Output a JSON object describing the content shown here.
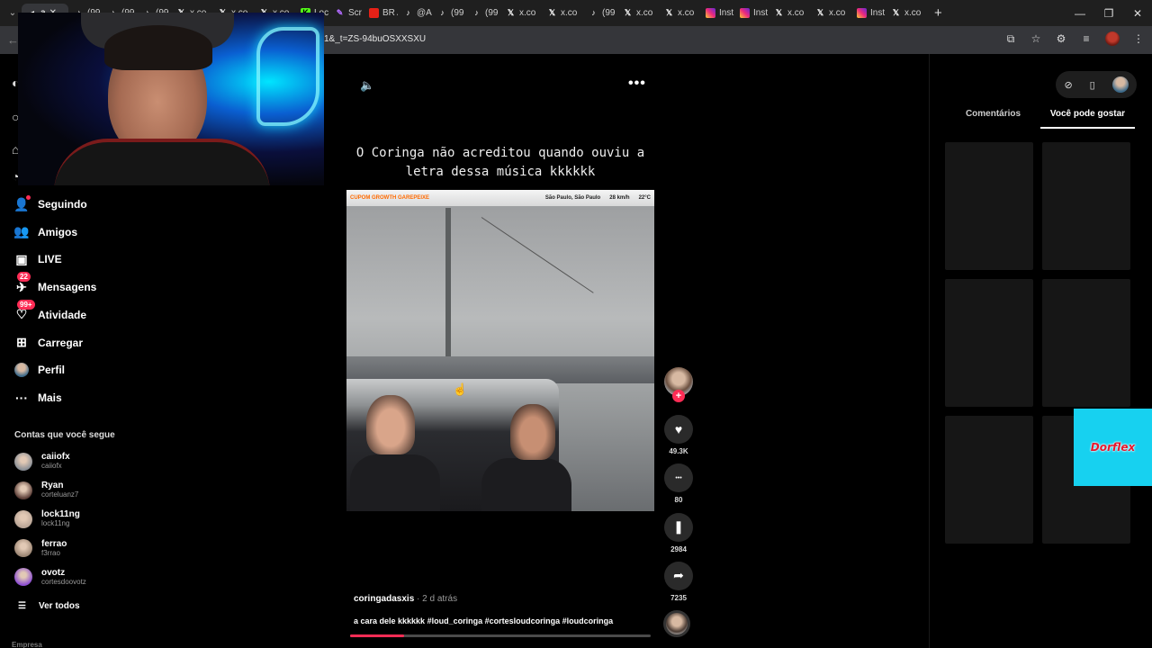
{
  "browser": {
    "tabs": [
      {
        "icon": "active-tab-icon",
        "label": "a",
        "type": "active"
      },
      {
        "icon": "tiktok-icon",
        "label": "(99",
        "type": "tt"
      },
      {
        "icon": "tiktok-icon",
        "label": "(99",
        "type": "tt"
      },
      {
        "icon": "tiktok-icon",
        "label": "(99",
        "type": "tt"
      },
      {
        "icon": "x-icon",
        "label": "x.co",
        "type": "x"
      },
      {
        "icon": "x-icon",
        "label": "x.co",
        "type": "x"
      },
      {
        "icon": "x-icon",
        "label": "x.co",
        "type": "x"
      },
      {
        "icon": "kick-icon",
        "label": "Loc",
        "type": "k"
      },
      {
        "icon": "screen-icon",
        "label": "Scr",
        "type": "sc"
      },
      {
        "icon": "youtube-icon",
        "label": "BR A",
        "type": "yt"
      },
      {
        "icon": "tiktok-icon",
        "label": "@A",
        "type": "tt"
      },
      {
        "icon": "tiktok-icon",
        "label": "(99",
        "type": "tt"
      },
      {
        "icon": "tiktok-icon",
        "label": "(99",
        "type": "tt"
      },
      {
        "icon": "x-icon",
        "label": "x.co",
        "type": "x"
      },
      {
        "icon": "x-icon",
        "label": "x.co",
        "type": "x"
      },
      {
        "icon": "tiktok-icon",
        "label": "(99",
        "type": "tt"
      },
      {
        "icon": "x-icon",
        "label": "x.co",
        "type": "x"
      },
      {
        "icon": "x-icon",
        "label": "x.co",
        "type": "x"
      },
      {
        "icon": "instagram-icon",
        "label": "Inst",
        "type": "ig"
      },
      {
        "icon": "instagram-icon",
        "label": "Inst",
        "type": "ig"
      },
      {
        "icon": "x-icon",
        "label": "x.co",
        "type": "x"
      },
      {
        "icon": "x-icon",
        "label": "x.co",
        "type": "x"
      },
      {
        "icon": "instagram-icon",
        "label": "Inst",
        "type": "ig"
      },
      {
        "icon": "x-icon",
        "label": "x.co",
        "type": "x"
      }
    ],
    "url": "1&_t=ZS-94buOSXXSXU"
  },
  "sidebar": {
    "items": [
      {
        "label": "Seguindo",
        "icon": "following-icon",
        "badge": "",
        "dot": true
      },
      {
        "label": "Amigos",
        "icon": "friends-icon",
        "badge": "",
        "dot": false
      },
      {
        "label": "LIVE",
        "icon": "live-icon",
        "badge": "",
        "dot": false
      },
      {
        "label": "Mensagens",
        "icon": "messages-icon",
        "badge": "22",
        "dot": false
      },
      {
        "label": "Atividade",
        "icon": "activity-icon",
        "badge": "99+",
        "dot": false
      },
      {
        "label": "Carregar",
        "icon": "upload-icon",
        "badge": "",
        "dot": false
      },
      {
        "label": "Perfil",
        "icon": "profile-avatar",
        "badge": "",
        "dot": false
      },
      {
        "label": "Mais",
        "icon": "more-icon",
        "badge": "",
        "dot": false
      }
    ],
    "following_title": "Contas que você segue",
    "accounts": [
      {
        "name": "caiiofx",
        "handle": "caiiofx",
        "color": "#8a8f96"
      },
      {
        "name": "Ryan",
        "handle": "corteluanz7",
        "color": "#5a3d36"
      },
      {
        "name": "lock11ng",
        "handle": "lock11ng",
        "color": "#b9a596"
      },
      {
        "name": "ferrao",
        "handle": "f3rrao",
        "color": "#9c8674"
      },
      {
        "name": "ovotz",
        "handle": "cortesdoovotz",
        "color": "#8d4fd1"
      }
    ],
    "see_all": "Ver todos",
    "footer": "Empresa"
  },
  "video": {
    "caption_overlay": "O Coringa não acreditou quando ouviu a letra dessa música kkkkkk",
    "hud_brand": "CUPOM GROWTH GAREPEIXE",
    "hud_location": "São Paulo, São Paulo",
    "hud_speed": "28 km/h",
    "hud_temp": "22°C",
    "author": "coringadasxis",
    "time": "· 2 d atrás",
    "description": "a cara dele kkkkkk #loud_coringa #cortesloudcoringa #loudcoringa",
    "progress": 0.18,
    "actions": [
      {
        "name": "like",
        "icon": "heart-icon",
        "glyph": "♥",
        "count": "49.3K"
      },
      {
        "name": "comment",
        "icon": "comment-icon",
        "glyph": "•••",
        "count": "80"
      },
      {
        "name": "save",
        "icon": "bookmark-icon",
        "glyph": "❚",
        "count": "2984"
      },
      {
        "name": "share",
        "icon": "share-icon",
        "glyph": "➦",
        "count": "7235"
      }
    ]
  },
  "right_panel": {
    "tabs": [
      "Comentários",
      "Você pode gostar"
    ],
    "selected_tab": 1
  },
  "ad": {
    "text": "Dorflex"
  },
  "colors": {
    "accent": "#fe2c55",
    "ad_bg": "#17d1f0"
  }
}
